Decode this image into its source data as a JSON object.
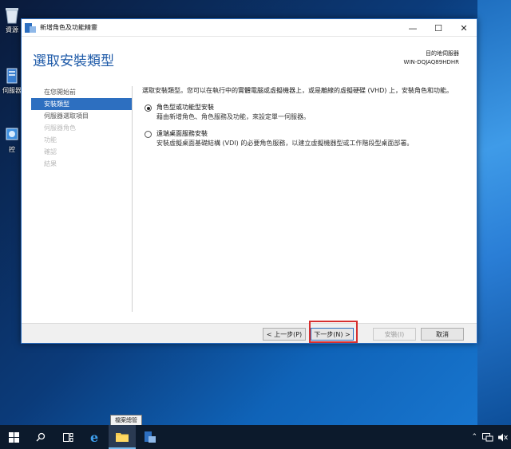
{
  "desktop": {
    "icons": [
      {
        "label": "資源"
      },
      {
        "label": "伺服器"
      },
      {
        "label": "控"
      }
    ]
  },
  "window": {
    "title": "新增角色及功能精靈",
    "controls": {
      "minimize": "—",
      "maximize": "☐",
      "close": "✕"
    },
    "page_title": "選取安裝類型",
    "destination_label": "目的地伺服器",
    "destination_server": "WIN-DQJAQ89HDHR"
  },
  "sidebar": {
    "items": [
      {
        "label": "在您開始前",
        "state": "normal"
      },
      {
        "label": "安裝類型",
        "state": "active"
      },
      {
        "label": "伺服器選取項目",
        "state": "normal"
      },
      {
        "label": "伺服器角色",
        "state": "disabled"
      },
      {
        "label": "功能",
        "state": "disabled"
      },
      {
        "label": "確認",
        "state": "disabled"
      },
      {
        "label": "結果",
        "state": "disabled"
      }
    ]
  },
  "content": {
    "description": "選取安裝類型。您可以在執行中的實體電腦或虛擬機器上，或是離線的虛擬硬碟 (VHD) 上，安裝角色和功能。",
    "options": [
      {
        "title": "角色型或功能型安裝",
        "desc": "藉由新增角色、角色服務及功能，來設定單一伺服器。",
        "checked": true
      },
      {
        "title": "遠端桌面服務安裝",
        "desc": "安裝虛擬桌面基礎結構 (VDI) 的必要角色服務，以建立虛擬機器型或工作階段型桌面部署。",
        "checked": false
      }
    ]
  },
  "footer": {
    "prev": "< 上一步(P)",
    "next": "下一步(N) >",
    "install": "安裝(I)",
    "cancel": "取消"
  },
  "taskbar": {
    "tooltip": "檔案總管"
  },
  "colors": {
    "accent": "#2d6fc0",
    "title_blue": "#1e5aa8",
    "highlight": "#d62f2f",
    "taskbar": "#0c1a2c"
  }
}
